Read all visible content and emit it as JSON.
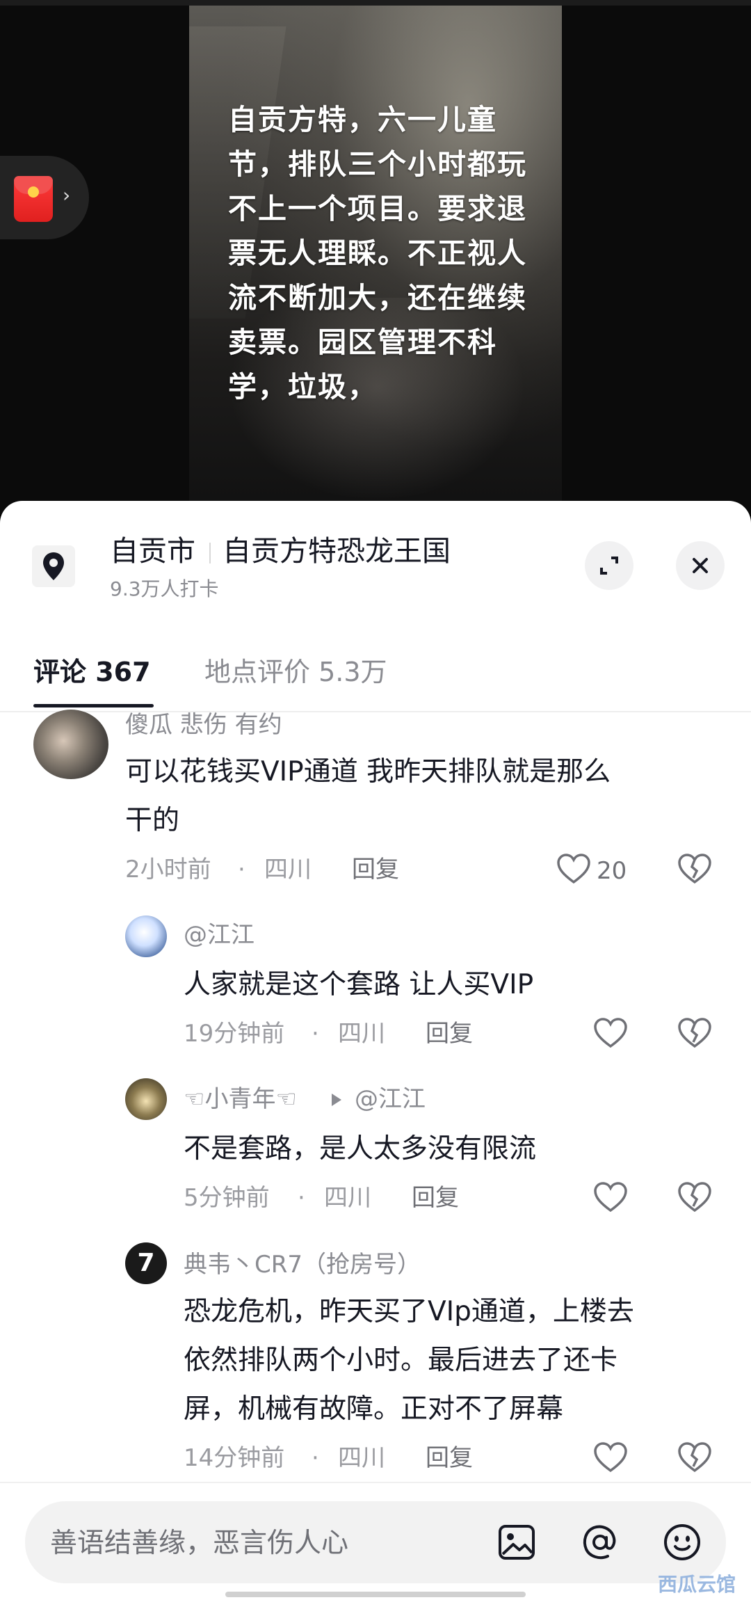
{
  "video": {
    "caption": "自贡方特，六一儿童节，排队三个小时都玩不上一个项目。要求退票无人理睬。不正视人流不断加大，还在继续卖票。园区管理不科学，垃圾，"
  },
  "location": {
    "city": "自贡市",
    "name": "自贡方特恐龙王国",
    "checkins": "9.3万人打卡",
    "icon": "location-pin-icon"
  },
  "tabs": {
    "comments": "评论 367",
    "reviews": "地点评价 5.3万"
  },
  "comments": [
    {
      "user": "傻瓜 悲伤 有约",
      "text_line1": "可以花钱买VIP通道  我昨天排队就是那么",
      "text_line2": "干的",
      "time": "2小时前",
      "dot": "·",
      "region": "四川",
      "reply": "回复",
      "likes": "20"
    },
    {
      "user": "@江江",
      "text_line1": "人家就是这个套路  让人买VIP",
      "time": "19分钟前",
      "dot": "·",
      "region": "四川",
      "reply": "回复"
    },
    {
      "user": "☜小青年☜",
      "reply_to": "@江江",
      "text_line1": "不是套路，是人太多没有限流",
      "time": "5分钟前",
      "dot": "·",
      "region": "四川",
      "reply": "回复"
    },
    {
      "user": "典韦丶CR7（抢房号）",
      "text_line1": "恐龙危机，昨天买了VIp通道，上楼去",
      "text_line2": "依然排队两个小时。最后进去了还卡",
      "text_line3": "屏，机械有故障。正对不了屏幕",
      "time": "14分钟前",
      "dot": "·",
      "region": "四川",
      "reply": "回复",
      "avatar_glyph": "7"
    }
  ],
  "input": {
    "placeholder": "善语结善缘，恶言伤人心"
  },
  "icons": {
    "expand": "expand-icon",
    "close": "close-icon",
    "image": "image-icon",
    "mention": "at-icon",
    "emoji": "emoji-icon"
  },
  "watermark": "西瓜云馆",
  "colors": {
    "accent_red": "#e0201f",
    "text_primary": "#161823",
    "text_secondary": "#8a8b91"
  }
}
